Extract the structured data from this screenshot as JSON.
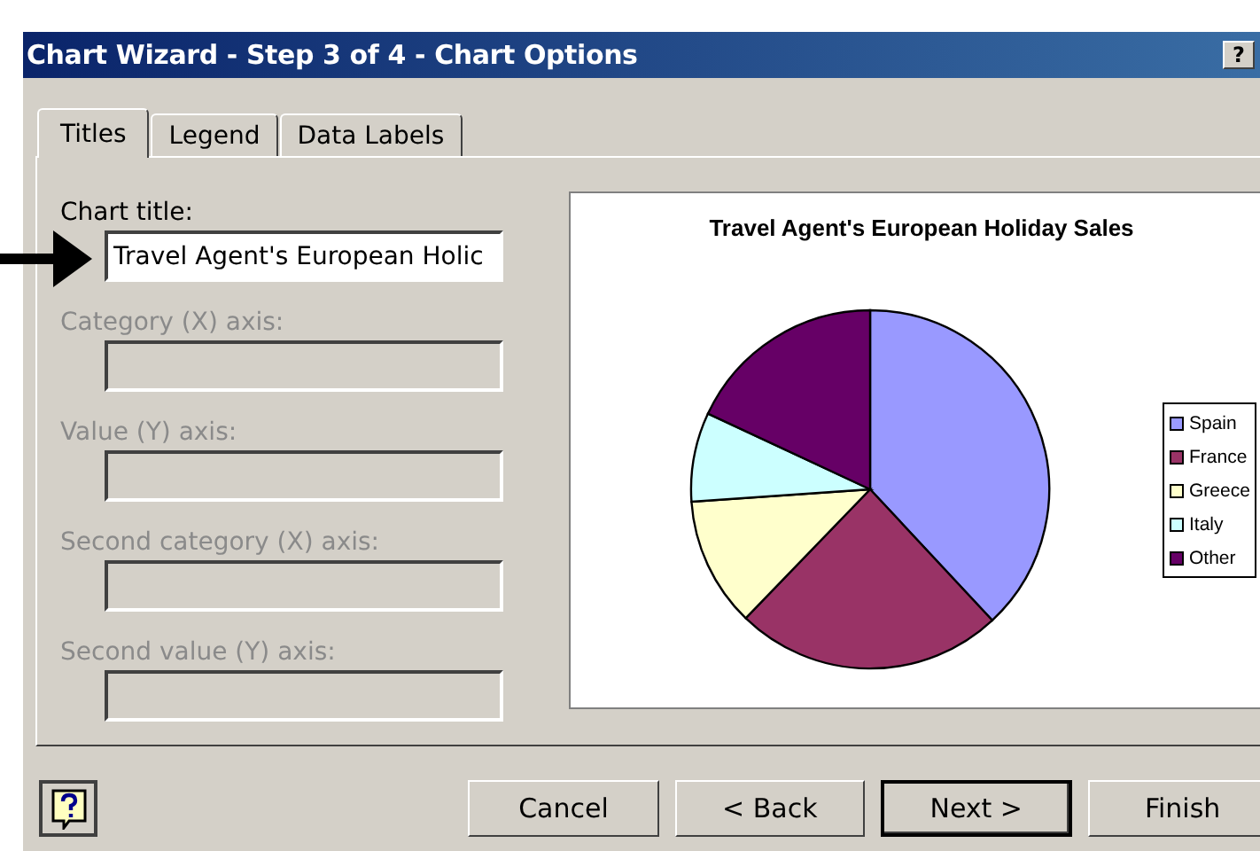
{
  "window": {
    "title": "Chart Wizard - Step 3 of 4 - Chart Options",
    "help_button": "?"
  },
  "tabs": [
    {
      "label": "Titles",
      "selected": true
    },
    {
      "label": "Legend",
      "selected": false
    },
    {
      "label": "Data Labels",
      "selected": false
    }
  ],
  "fields": [
    {
      "label": "Chart title:",
      "value": "Travel Agent's European Holic",
      "disabled": false
    },
    {
      "label": "Category (X) axis:",
      "disabled": true
    },
    {
      "label": "Value (Y) axis:",
      "disabled": true
    },
    {
      "label": "Second category (X) axis:",
      "disabled": true
    },
    {
      "label": "Second value (Y) axis:",
      "disabled": true
    }
  ],
  "preview": {
    "title": "Travel Agent's European Holiday Sales",
    "legend": [
      {
        "label": "Spain",
        "color": "#9999ff"
      },
      {
        "label": "France",
        "color": "#993366"
      },
      {
        "label": "Greece",
        "color": "#ffffcc"
      },
      {
        "label": "Italy",
        "color": "#ccffff"
      },
      {
        "label": "Other",
        "color": "#660066"
      }
    ]
  },
  "buttons": [
    {
      "label": "Cancel",
      "default": false
    },
    {
      "label": "< Back",
      "default": false
    },
    {
      "label": "Next >",
      "default": true
    },
    {
      "label": "Finish",
      "default": false
    }
  ]
}
